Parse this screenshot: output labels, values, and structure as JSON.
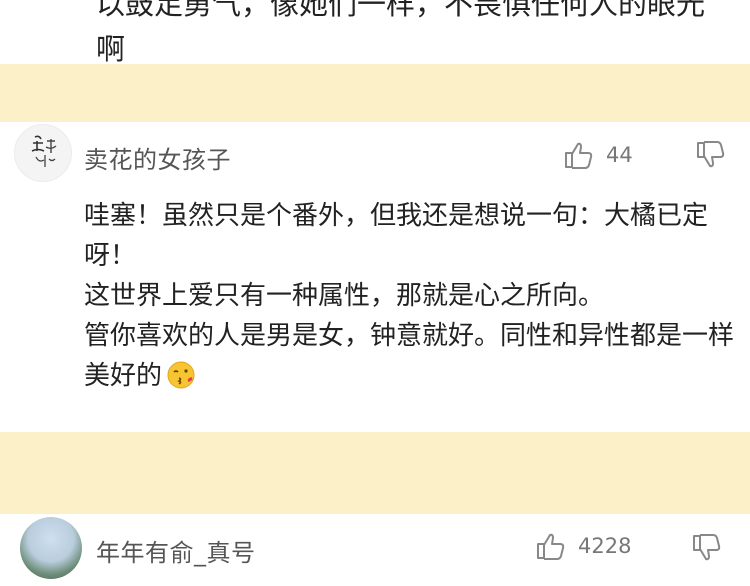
{
  "prev_comment": {
    "lines": [
      "以鼓足勇气，像她们一样，不畏惧任何人的眼光",
      "啊"
    ]
  },
  "comments": [
    {
      "username": "卖花的女孩子",
      "likes": "44",
      "paragraphs": [
        "哇塞！虽然只是个番外，但我还是想说一句：大橘已定呀！",
        "这世界上爱只有一种属性，那就是心之所向。",
        "管你喜欢的人是男是女，钟意就好。同性和异性都是一样美好的"
      ],
      "emoji": "kissing-face-emoji"
    },
    {
      "username": "年年有俞_真号",
      "likes": "4228"
    }
  ],
  "colors": {
    "separator_band": "#fbf0c8",
    "text": "#222222",
    "meta": "#777777"
  },
  "icons": [
    "thumbs-up-icon",
    "thumbs-down-icon"
  ]
}
